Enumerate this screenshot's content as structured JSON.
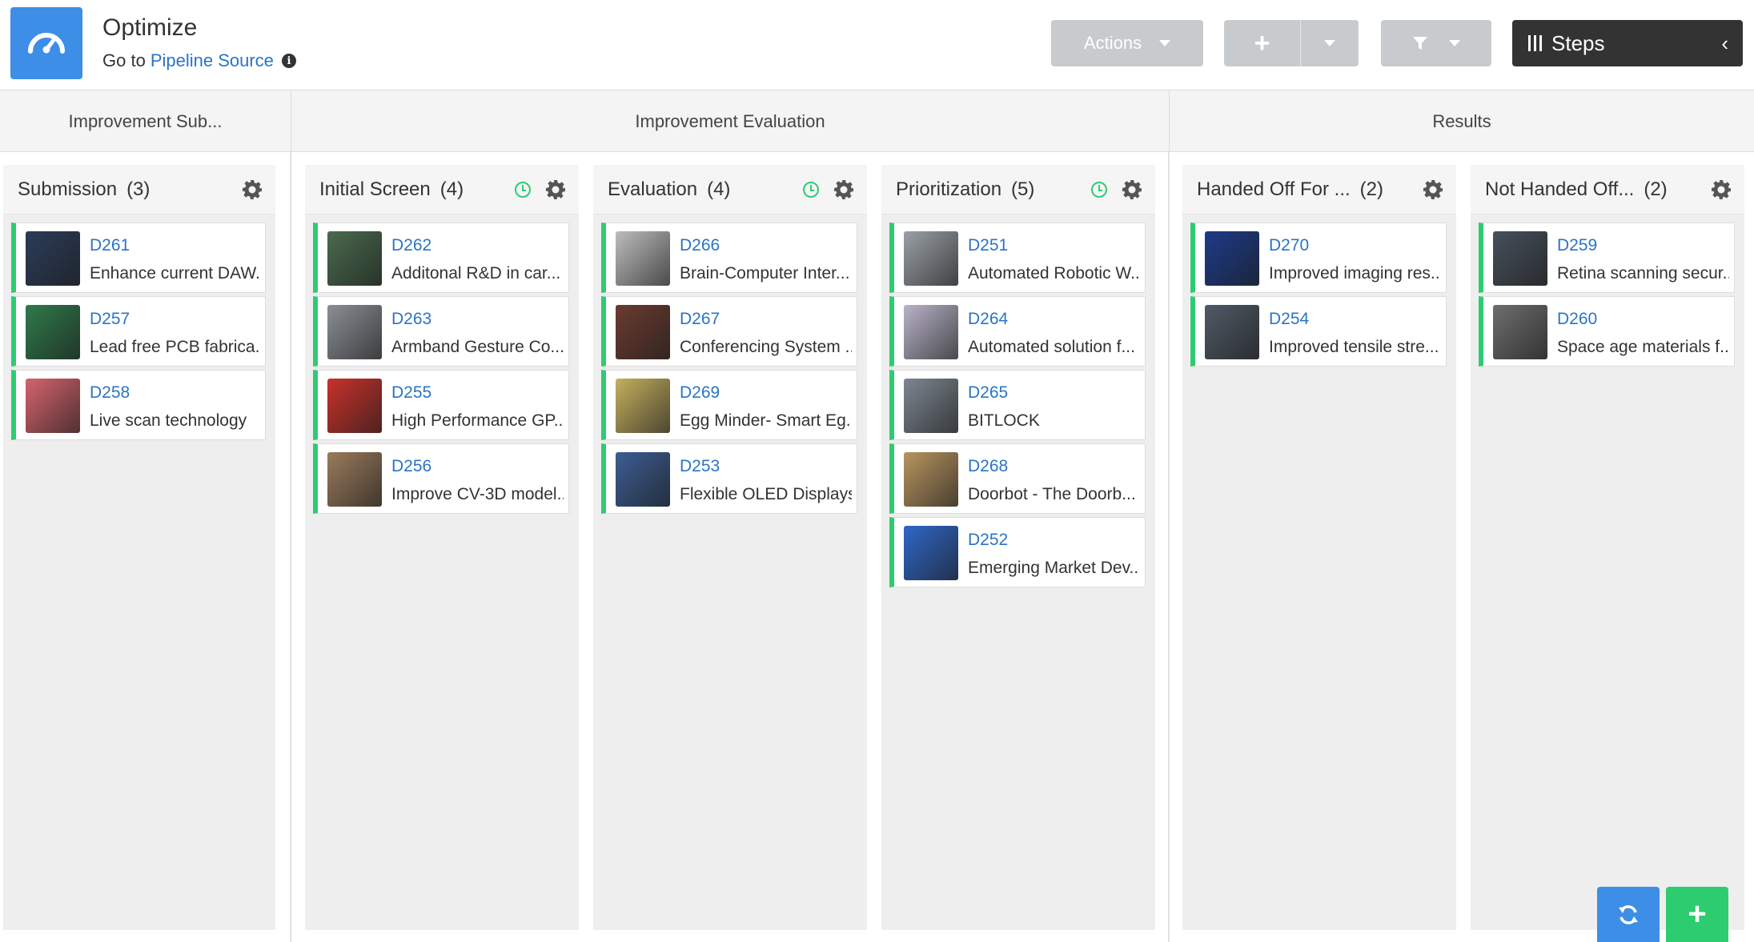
{
  "header": {
    "title": "Optimize",
    "goto_prefix": "Go to",
    "goto_link": "Pipeline Source",
    "actions_label": "Actions",
    "add_label": "+",
    "steps_label": "Steps",
    "collapse_glyph": "‹"
  },
  "groups": [
    {
      "label": "Improvement Sub..."
    },
    {
      "label": "Improvement Evaluation"
    },
    {
      "label": "Results"
    }
  ],
  "columns": [
    {
      "title": "Submission",
      "count": "(3)",
      "timer": false,
      "cards": [
        {
          "id": "D261",
          "title": "Enhance current DAW...",
          "thumb": "#2b3c58"
        },
        {
          "id": "D257",
          "title": "Lead free PCB fabrica...",
          "thumb": "#2f7a4a"
        },
        {
          "id": "D258",
          "title": "Live scan technology",
          "thumb": "#d5646d"
        }
      ]
    },
    {
      "title": "Initial Screen",
      "count": "(4)",
      "timer": true,
      "cards": [
        {
          "id": "D262",
          "title": "Additonal R&D in car...",
          "thumb": "#4a6b4e"
        },
        {
          "id": "D263",
          "title": "Armband Gesture Co...",
          "thumb": "#8b8f95"
        },
        {
          "id": "D255",
          "title": "High Performance GP...",
          "thumb": "#c9312b"
        },
        {
          "id": "D256",
          "title": "Improve CV-3D model...",
          "thumb": "#9a7b5c"
        }
      ]
    },
    {
      "title": "Evaluation",
      "count": "(4)",
      "timer": true,
      "cards": [
        {
          "id": "D266",
          "title": "Brain-Computer Inter...",
          "thumb": "#bdbdbd"
        },
        {
          "id": "D267",
          "title": "Conferencing System ...",
          "thumb": "#6b3b2f"
        },
        {
          "id": "D269",
          "title": "Egg Minder- Smart Eg...",
          "thumb": "#c4b060"
        },
        {
          "id": "D253",
          "title": "Flexible OLED Displays",
          "thumb": "#3c5d93"
        }
      ]
    },
    {
      "title": "Prioritization",
      "count": "(5)",
      "timer": true,
      "cards": [
        {
          "id": "D251",
          "title": "Automated Robotic W...",
          "thumb": "#9aa0a6"
        },
        {
          "id": "D264",
          "title": "Automated solution f...",
          "thumb": "#b9b4c8"
        },
        {
          "id": "D265",
          "title": "BITLOCK",
          "thumb": "#7d8690"
        },
        {
          "id": "D268",
          "title": "Doorbot - The Doorb...",
          "thumb": "#b89560"
        },
        {
          "id": "D252",
          "title": "Emerging Market Dev...",
          "thumb": "#2f67c7"
        }
      ]
    },
    {
      "title": "Handed Off For ...",
      "count": "(2)",
      "timer": false,
      "cards": [
        {
          "id": "D270",
          "title": "Improved imaging res...",
          "thumb": "#1d3b8a"
        },
        {
          "id": "D254",
          "title": "Improved tensile stre...",
          "thumb": "#505a66"
        }
      ]
    },
    {
      "title": "Not Handed Off...",
      "count": "(2)",
      "timer": false,
      "cards": [
        {
          "id": "D259",
          "title": "Retina scanning secur...",
          "thumb": "#47505c"
        },
        {
          "id": "D260",
          "title": "Space age materials f...",
          "thumb": "#6e6e6e"
        }
      ]
    }
  ],
  "colors": {
    "accent": "#3d8ee6",
    "status": "#2ecc71",
    "link": "#2a74c4",
    "steps_bg": "#333333"
  }
}
